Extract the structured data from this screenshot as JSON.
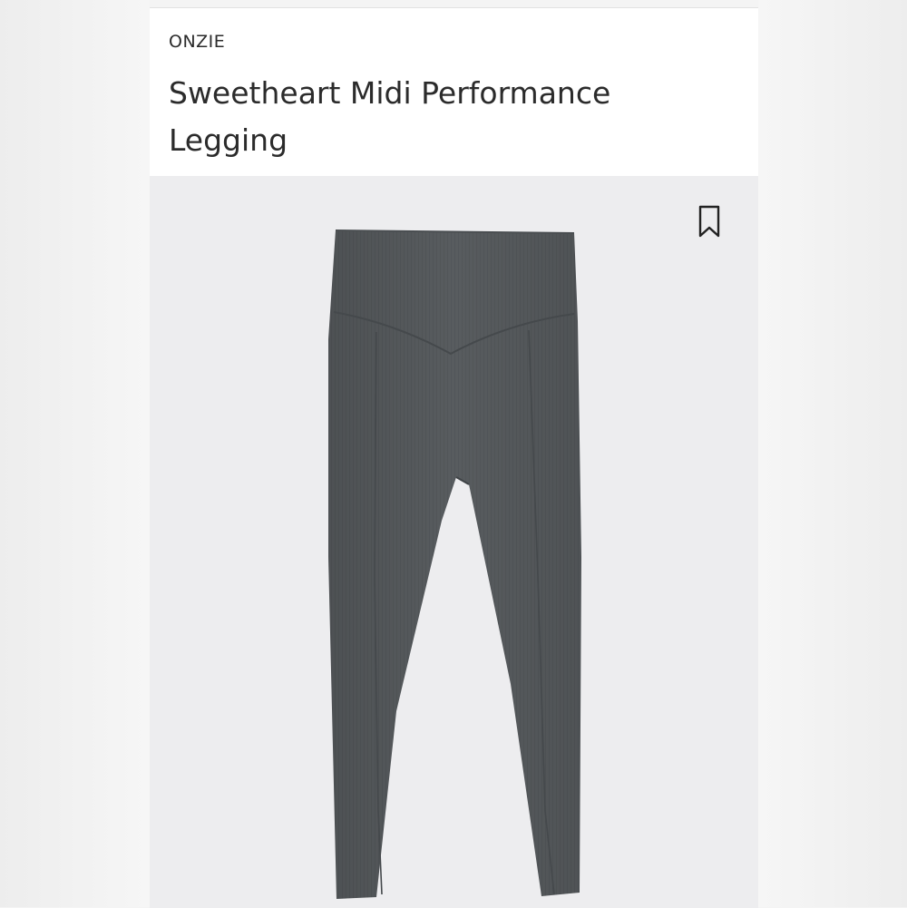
{
  "product": {
    "brand": "ONZIE",
    "title": "Sweetheart Midi Performance Legging"
  },
  "icons": {
    "bookmark": "bookmark-icon"
  },
  "colors": {
    "legging": "#585c5f",
    "image_background": "#ededef",
    "text": "#2b2b2b"
  }
}
